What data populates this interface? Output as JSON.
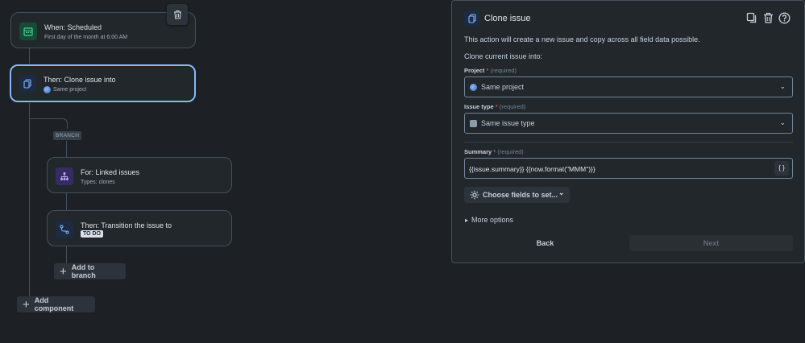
{
  "flow": {
    "trigger": {
      "title": "When: Scheduled",
      "subtitle": "First day of the month at 6:00 AM"
    },
    "clone": {
      "title": "Then: Clone issue into",
      "subtitle": "Same project"
    },
    "branch_label": "BRANCH",
    "linked": {
      "title": "For: Linked issues",
      "subtitle": "Types: clones"
    },
    "transition": {
      "title": "Then: Transition the issue to",
      "status": "TO DO"
    },
    "add_to_branch": "Add to branch",
    "add_component": "Add component"
  },
  "panel": {
    "title": "Clone issue",
    "description": "This action will create a new issue and copy across all field data possible.",
    "clone_into": "Clone current issue into:",
    "project": {
      "label": "Project",
      "star": "*",
      "required": "(required)",
      "value": "Same project"
    },
    "issue_type": {
      "label": "Issue type",
      "star": "*",
      "required": "(required)",
      "value": "Same issue type"
    },
    "summary": {
      "label": "Summary",
      "star": "*",
      "required": "(required)",
      "value": "{{issue.summary}} {{now.format(\"MMM\")}}",
      "brace": "{ }"
    },
    "choose_fields": "Choose fields to set...",
    "more_options": "More options",
    "back": "Back",
    "next": "Next"
  },
  "colors": {
    "accent": "#579dff",
    "background": "#1d2125",
    "card": "#22272b"
  }
}
